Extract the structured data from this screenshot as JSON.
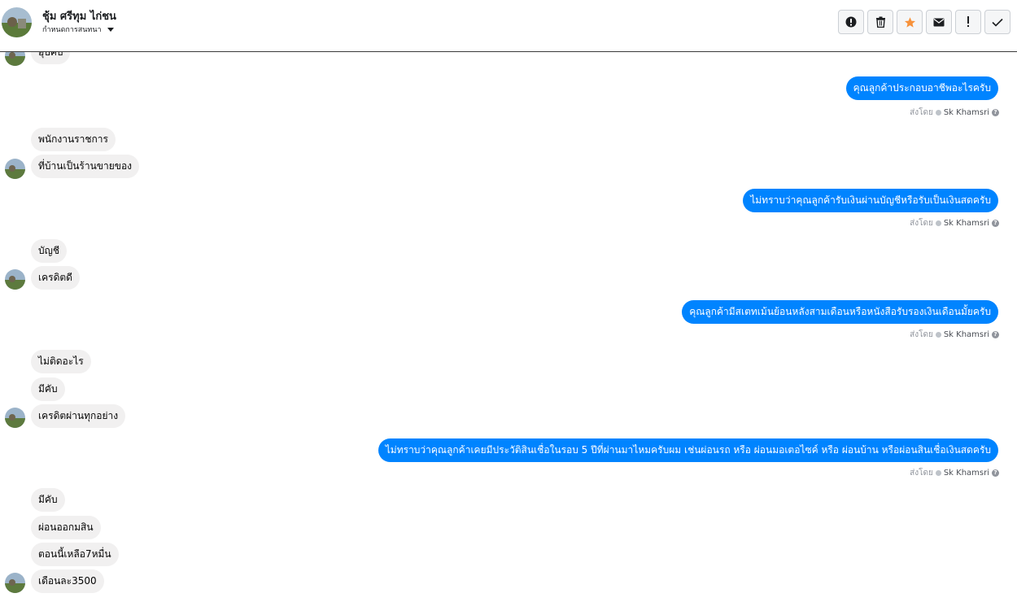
{
  "header": {
    "contact_name": "ชุ้ม ศรีทุม ไก่ชน",
    "settings_label": "กำหนดการสนทนา",
    "buttons": [
      "spam-button",
      "delete-button",
      "star-button",
      "mark-unread-button",
      "important-button",
      "done-button"
    ]
  },
  "messages": {
    "in_partial": "อุ๊บคับ",
    "out_1": "คุณลูกค้าประกอบอาชีพอะไรครับ",
    "in_1a": "พนักงานราชการ",
    "in_1b": "ที่บ้านเป็นร้านขายของ",
    "out_2": "ไม่ทราบว่าคุณลูกค้ารับเงินผ่านบัญชีหรือรับเป็นเงินสดครับ",
    "in_2a": "บัญชี",
    "in_2b": "เครดิตดี",
    "out_3": "คุณลูกค้ามีสเตทเม้นย้อนหลังสามเดือนหรือหนังสือรับรองเงินเดือนมั้ยครับ",
    "in_3a": "ไม่ติดอะไร",
    "in_3b": "มีคับ",
    "in_3c": "เครดิตผ่านทุกอย่าง",
    "out_4": "ไม่ทราบว่าคุณลูกค้าเคยมีประวัติสินเชื่อในรอบ 5 ปีที่ผ่านมาไหมครับผม เช่นผ่อนรถ หรือ ผ่อนมอเตอไซค์ หรือ ผ่อนบ้าน หรือผ่อนสินเชื่อเงินสดครับ",
    "in_4a": "มีคับ",
    "in_4b": "ผ่อนออกมสิน",
    "in_4c": "ตอนนี้เหลือ7หมื่น",
    "in_4d": "เดือนละ3500"
  },
  "sent_by": {
    "prefix": "ส่งโดย",
    "name": "Sk Khamsri"
  },
  "colors": {
    "outgoing": "#0084ff",
    "incoming": "#f1f0f0",
    "star": "#f7923b"
  }
}
